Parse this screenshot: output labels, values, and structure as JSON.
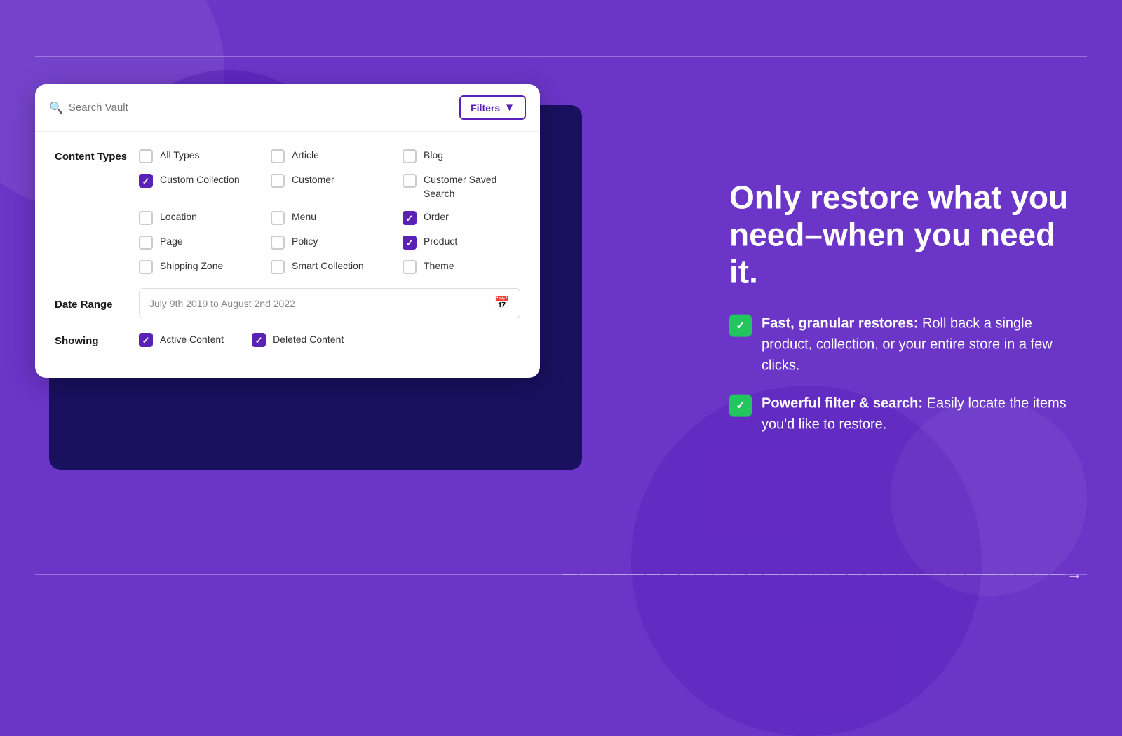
{
  "background": {
    "color": "#6B35C8"
  },
  "search": {
    "placeholder": "Search Vault"
  },
  "filters_button": {
    "label": "Filters"
  },
  "content_types": {
    "section_label": "Content Types",
    "items": [
      {
        "id": "all-types",
        "label": "All Types",
        "checked": false,
        "col": 1
      },
      {
        "id": "article",
        "label": "Article",
        "checked": false,
        "col": 2
      },
      {
        "id": "blog",
        "label": "Blog",
        "checked": false,
        "col": 3
      },
      {
        "id": "custom-collection",
        "label": "Custom Collection",
        "checked": true,
        "col": 1
      },
      {
        "id": "customer",
        "label": "Customer",
        "checked": false,
        "col": 2
      },
      {
        "id": "customer-saved-search",
        "label": "Customer Saved Search",
        "checked": false,
        "col": 3
      },
      {
        "id": "location",
        "label": "Location",
        "checked": false,
        "col": 1
      },
      {
        "id": "menu",
        "label": "Menu",
        "checked": false,
        "col": 2
      },
      {
        "id": "order",
        "label": "Order",
        "checked": true,
        "col": 3
      },
      {
        "id": "page",
        "label": "Page",
        "checked": false,
        "col": 1
      },
      {
        "id": "policy",
        "label": "Policy",
        "checked": false,
        "col": 2
      },
      {
        "id": "product",
        "label": "Product",
        "checked": true,
        "col": 3
      },
      {
        "id": "shipping-zone",
        "label": "Shipping Zone",
        "checked": false,
        "col": 1
      },
      {
        "id": "smart-collection",
        "label": "Smart Collection",
        "checked": false,
        "col": 2
      },
      {
        "id": "theme",
        "label": "Theme",
        "checked": false,
        "col": 3
      }
    ]
  },
  "date_range": {
    "section_label": "Date Range",
    "value": "July 9th 2019 to August 2nd 2022"
  },
  "showing": {
    "section_label": "Showing",
    "items": [
      {
        "id": "active-content",
        "label": "Active Content",
        "checked": true
      },
      {
        "id": "deleted-content",
        "label": "Deleted Content",
        "checked": true
      }
    ]
  },
  "right_panel": {
    "heading": "Only restore what you need–when you need it.",
    "features": [
      {
        "bold": "Fast, granular restores:",
        "text": " Roll back a single product, collection, or your entire store in a few clicks."
      },
      {
        "bold": "Powerful filter & search:",
        "text": " Easily locate the items you'd like to restore."
      }
    ]
  }
}
